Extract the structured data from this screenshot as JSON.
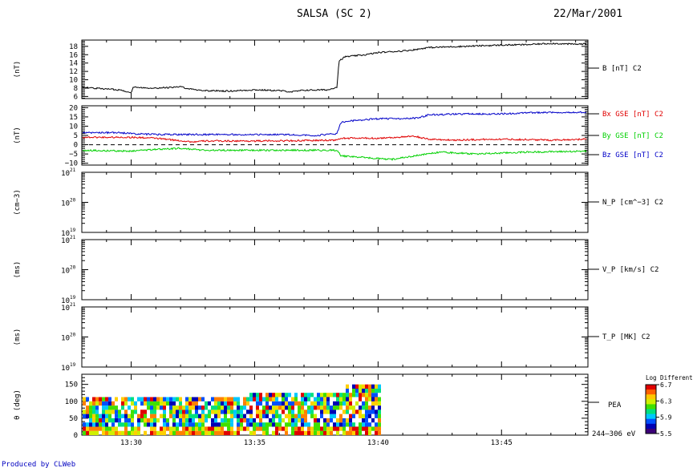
{
  "header": {
    "title": "SALSA (SC 2)",
    "date": "22/Mar/2001"
  },
  "footer": {
    "credit": "Produced by CLWeb"
  },
  "colors": {
    "black": "#000000",
    "red": "#e00000",
    "green": "#00d000",
    "blue": "#0000c8",
    "credit": "#0000c0"
  },
  "chart_data": [
    {
      "type": "line",
      "panel": "B magnitude",
      "ylabel": "(nT)",
      "ylim": [
        5.5,
        19.5
      ],
      "yticks": [
        6,
        8,
        10,
        12,
        14,
        16,
        18
      ],
      "xlim": [
        "13:28:00",
        "13:48:30"
      ],
      "xticks": [
        "13:30",
        "13:35",
        "13:40",
        "13:45"
      ],
      "series": [
        {
          "name": "B [nT] C2",
          "color": "#000000",
          "points": [
            [
              "13:28:00",
              8.2
            ],
            [
              "13:29:00",
              7.8
            ],
            [
              "13:29:30",
              7.6
            ],
            [
              "13:30:00",
              7.0
            ],
            [
              "13:30:05",
              8.2
            ],
            [
              "13:31:00",
              8.0
            ],
            [
              "13:32:00",
              8.3
            ],
            [
              "13:32:30",
              7.7
            ],
            [
              "13:33:00",
              7.4
            ],
            [
              "13:34:00",
              7.3
            ],
            [
              "13:35:00",
              7.6
            ],
            [
              "13:36:00",
              7.4
            ],
            [
              "13:36:30",
              7.1
            ],
            [
              "13:37:00",
              7.5
            ],
            [
              "13:38:00",
              7.6
            ],
            [
              "13:38:20",
              8.3
            ],
            [
              "13:38:25",
              14.5
            ],
            [
              "13:38:40",
              15.5
            ],
            [
              "13:39:30",
              16.0
            ],
            [
              "13:40:00",
              16.5
            ],
            [
              "13:41:00",
              16.9
            ],
            [
              "13:41:30",
              17.2
            ],
            [
              "13:42:00",
              17.7
            ],
            [
              "13:43:00",
              17.9
            ],
            [
              "13:44:00",
              18.1
            ],
            [
              "13:45:00",
              18.3
            ],
            [
              "13:46:00",
              18.4
            ],
            [
              "13:47:00",
              18.7
            ],
            [
              "13:48:00",
              18.5
            ],
            [
              "13:48:30",
              18.6
            ]
          ]
        }
      ],
      "legend": [
        "B [nT] C2"
      ]
    },
    {
      "type": "line",
      "panel": "B components",
      "ylabel": "(nT)",
      "ylim": [
        -11,
        21
      ],
      "yticks": [
        -10,
        -5,
        0,
        5,
        10,
        15,
        20
      ],
      "reference_line": 0,
      "xlim": [
        "13:28:00",
        "13:48:30"
      ],
      "series": [
        {
          "name": "Bx GSE [nT] C2",
          "color": "#e00000",
          "points": [
            [
              "13:28:00",
              4.0
            ],
            [
              "13:30:00",
              4.0
            ],
            [
              "13:31:00",
              3.5
            ],
            [
              "13:32:30",
              1.5
            ],
            [
              "13:33:00",
              2.0
            ],
            [
              "13:35:00",
              2.0
            ],
            [
              "13:37:00",
              2.2
            ],
            [
              "13:38:20",
              2.5
            ],
            [
              "13:38:30",
              3.5
            ],
            [
              "13:40:00",
              3.5
            ],
            [
              "13:41:30",
              4.5
            ],
            [
              "13:42:00",
              3.0
            ],
            [
              "13:43:00",
              2.5
            ],
            [
              "13:45:00",
              3.0
            ],
            [
              "13:47:00",
              2.5
            ],
            [
              "13:48:30",
              3.0
            ]
          ]
        },
        {
          "name": "By GSE [nT] C2",
          "color": "#00d000",
          "points": [
            [
              "13:28:00",
              -3.0
            ],
            [
              "13:30:00",
              -3.5
            ],
            [
              "13:31:00",
              -2.5
            ],
            [
              "13:32:00",
              -2.0
            ],
            [
              "13:33:00",
              -3.0
            ],
            [
              "13:35:00",
              -3.0
            ],
            [
              "13:37:00",
              -3.0
            ],
            [
              "13:38:20",
              -3.0
            ],
            [
              "13:38:30",
              -6.0
            ],
            [
              "13:39:30",
              -7.0
            ],
            [
              "13:40:30",
              -8.0
            ],
            [
              "13:41:30",
              -6.0
            ],
            [
              "13:42:30",
              -4.0
            ],
            [
              "13:44:00",
              -5.0
            ],
            [
              "13:46:00",
              -4.0
            ],
            [
              "13:48:30",
              -3.5
            ]
          ]
        },
        {
          "name": "Bz GSE [nT] C2",
          "color": "#0000c8",
          "points": [
            [
              "13:28:00",
              6.5
            ],
            [
              "13:29:30",
              6.5
            ],
            [
              "13:30:00",
              6.0
            ],
            [
              "13:31:00",
              5.5
            ],
            [
              "13:32:00",
              5.5
            ],
            [
              "13:34:00",
              5.5
            ],
            [
              "13:36:00",
              5.5
            ],
            [
              "13:37:30",
              5.0
            ],
            [
              "13:38:20",
              6.0
            ],
            [
              "13:38:30",
              12.0
            ],
            [
              "13:39:00",
              13.0
            ],
            [
              "13:40:00",
              14.0
            ],
            [
              "13:41:00",
              14.0
            ],
            [
              "13:41:40",
              14.5
            ],
            [
              "13:42:00",
              16.0
            ],
            [
              "13:43:00",
              16.5
            ],
            [
              "13:45:00",
              16.7
            ],
            [
              "13:47:00",
              17.5
            ],
            [
              "13:48:30",
              17.5
            ]
          ]
        }
      ],
      "legend": [
        "Bx GSE [nT] C2",
        "By GSE [nT] C2",
        "Bz GSE [nT] C2"
      ]
    },
    {
      "type": "line",
      "panel": "N_P",
      "ylabel": "(cm−3)",
      "yscale": "log",
      "ylim": [
        1e+19,
        1e+21
      ],
      "ytick_labels": [
        "10",
        "10",
        "10"
      ],
      "ytick_exponents": [
        "21",
        "20",
        "19"
      ],
      "series": [],
      "legend": [
        "N_P [cm^−3] C2"
      ]
    },
    {
      "type": "line",
      "panel": "V_P",
      "ylabel": "(ms)",
      "yscale": "log",
      "ylim": [
        1e+19,
        1e+21
      ],
      "ytick_labels": [
        "10",
        "10",
        "10"
      ],
      "ytick_exponents": [
        "21",
        "20",
        "19"
      ],
      "series": [],
      "legend": [
        "V_P [km/s] C2"
      ]
    },
    {
      "type": "line",
      "panel": "T_P",
      "ylabel": "(ms)",
      "yscale": "log",
      "ylim": [
        1e+19,
        1e+21
      ],
      "ytick_labels": [
        "10",
        "10",
        "10"
      ],
      "ytick_exponents": [
        "21",
        "20",
        "19"
      ],
      "series": [],
      "legend": [
        "T_P [MK] C2"
      ]
    },
    {
      "type": "heatmap",
      "panel": "PEA pitch angle",
      "ylabel": "θ (deg)",
      "ylim": [
        0,
        180
      ],
      "yticks": [
        0,
        50,
        100,
        150
      ],
      "data_range": [
        "13:28:00",
        "13:40:00"
      ],
      "label": "PEA",
      "energy_label": "244–306 eV",
      "colorbar_title": "Log Differential",
      "colorbar_range": [
        5.5,
        6.7
      ],
      "colorbar_ticks": [
        "6.7",
        "6.3",
        "5.9",
        "5.5"
      ],
      "xticks": [
        "13:30",
        "13:35",
        "13:40",
        "13:45"
      ]
    }
  ]
}
